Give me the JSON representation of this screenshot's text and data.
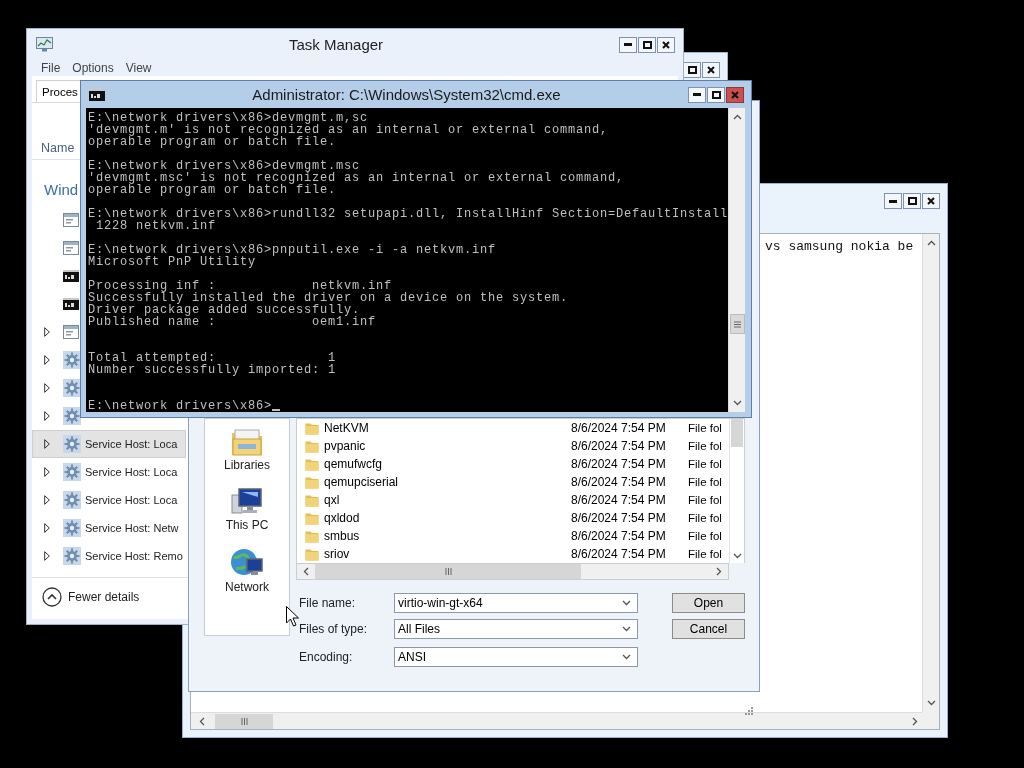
{
  "task_manager": {
    "title": "Task Manager",
    "menu": [
      "File",
      "Options",
      "View"
    ],
    "tabs": [
      {
        "label": "Proces",
        "selected": true
      }
    ],
    "column": "Name",
    "group": "Wind",
    "rows": [
      {
        "kind": "app",
        "expandable": false,
        "highlighted": false
      },
      {
        "kind": "app",
        "expandable": false,
        "highlighted": false
      },
      {
        "kind": "console",
        "expandable": false,
        "highlighted": false
      },
      {
        "kind": "console",
        "expandable": false,
        "highlighted": false
      },
      {
        "kind": "app",
        "expandable": true,
        "highlighted": false
      },
      {
        "kind": "gear",
        "expandable": true,
        "highlighted": false
      },
      {
        "kind": "gear",
        "expandable": true,
        "highlighted": false
      },
      {
        "kind": "gear",
        "expandable": true,
        "highlighted": false
      },
      {
        "kind": "gear",
        "expandable": true,
        "highlighted": true,
        "name": "Service Host: Loca"
      },
      {
        "kind": "gear",
        "expandable": true,
        "highlighted": false,
        "name": "Service Host: Loca"
      },
      {
        "kind": "gear",
        "expandable": true,
        "highlighted": false,
        "name": "Service Host: Loca"
      },
      {
        "kind": "gear",
        "expandable": true,
        "highlighted": false,
        "name": "Service Host: Netw"
      },
      {
        "kind": "gear",
        "expandable": true,
        "highlighted": false,
        "name": "Service Host: Remo"
      }
    ],
    "footer": "Fewer details"
  },
  "cmd": {
    "title": "Administrator: C:\\Windows\\System32\\cmd.exe",
    "output": "E:\\network drivers\\x86>devmgmt.m,sc\n'devmgmt.m' is not recognized as an internal or external command,\noperable program or batch file.\n\nE:\\network drivers\\x86>devmgmt.msc\n'devmgmt.msc' is not recognized as an internal or external command,\noperable program or batch file.\n\nE:\\network drivers\\x86>rundll32 setupapi.dll, InstallHinf Section=DefaultInstall\n 1228 netkvm.inf\n\nE:\\network drivers\\x86>pnputil.exe -i -a netkvm.inf\nMicrosoft PnP Utility\n\nProcessing inf :            netkvm.inf\nSuccessfully installed the driver on a device on the system.\nDriver package added successfully.\nPublished name :            oem1.inf\n\n\nTotal attempted:              1\nNumber successfully imported: 1\n\n\nE:\\network drivers\\x86>"
  },
  "open_dialog": {
    "places": [
      {
        "kind": "libraries",
        "label": "Libraries"
      },
      {
        "kind": "pc",
        "label": "This PC"
      },
      {
        "kind": "network",
        "label": "Network"
      }
    ],
    "files": [
      {
        "name": "NetKVM",
        "date": "8/6/2024 7:54 PM",
        "type": "File fol"
      },
      {
        "name": "pvpanic",
        "date": "8/6/2024 7:54 PM",
        "type": "File fol"
      },
      {
        "name": "qemufwcfg",
        "date": "8/6/2024 7:54 PM",
        "type": "File fol"
      },
      {
        "name": "qemupciserial",
        "date": "8/6/2024 7:54 PM",
        "type": "File fol"
      },
      {
        "name": "qxl",
        "date": "8/6/2024 7:54 PM",
        "type": "File fol"
      },
      {
        "name": "qxldod",
        "date": "8/6/2024 7:54 PM",
        "type": "File fol"
      },
      {
        "name": "smbus",
        "date": "8/6/2024 7:54 PM",
        "type": "File fol"
      },
      {
        "name": "sriov",
        "date": "8/6/2024 7:54 PM",
        "type": "File fol"
      }
    ],
    "fields": [
      {
        "label": "File name:",
        "value": "virtio-win-gt-x64"
      },
      {
        "label": "Files of type:",
        "value": "All Files"
      },
      {
        "label": "Encoding:",
        "value": "ANSI"
      }
    ],
    "buttons": [
      "Open",
      "Cancel"
    ]
  },
  "notepad": {
    "text": "vs samsung nokia be"
  }
}
